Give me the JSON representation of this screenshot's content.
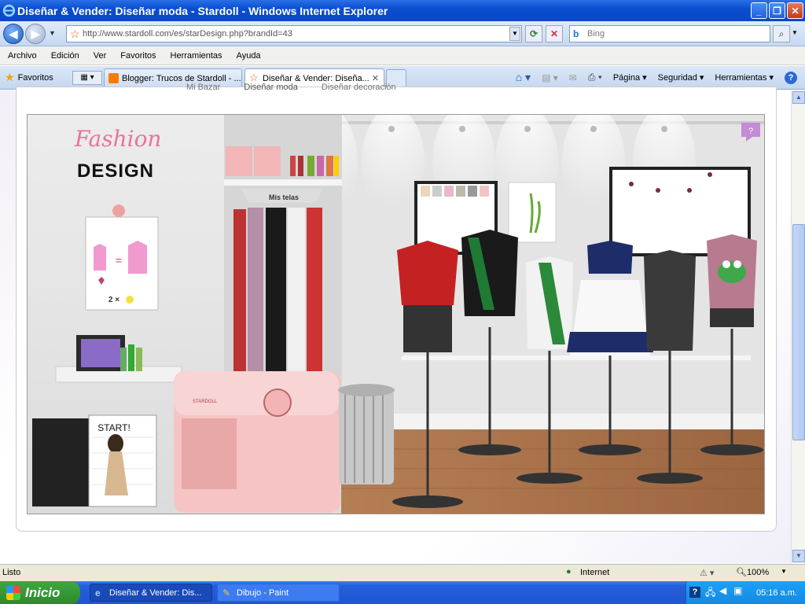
{
  "window": {
    "title": "Diseñar & Vender: Diseñar moda - Stardoll - Windows Internet Explorer"
  },
  "address": {
    "url": "http://www.stardoll.com/es/starDesign.php?brandId=43",
    "search_placeholder": "Bing"
  },
  "menu": [
    "Archivo",
    "Edición",
    "Ver",
    "Favoritos",
    "Herramientas",
    "Ayuda"
  ],
  "favorites": {
    "label": "Favoritos"
  },
  "tabs": [
    {
      "label": "Blogger: Trucos de Stardoll - ..."
    },
    {
      "label": "Diseñar & Vender: Diseña..."
    }
  ],
  "commands": [
    "Página",
    "Seguridad",
    "Herramientas"
  ],
  "page": {
    "subtabs": [
      "Mi Bazar",
      "Diseñar moda",
      "Diseñar decoración"
    ],
    "logo_top": "Fashion",
    "logo_bottom": "DESIGN",
    "shelf_label": "Mis telas",
    "equation_cost": "2 ×",
    "start_label": "START!",
    "brand": "STARDOLL",
    "help": "?"
  },
  "status": {
    "text": "Listo",
    "zone": "Internet",
    "zoom": "100%"
  },
  "taskbar": {
    "start": "Inicio",
    "items": [
      "Diseñar & Vender: Dis...",
      "Dibujo - Paint"
    ],
    "time": "05:16 a.m."
  },
  "colors": {
    "titlebar": "#0b47c4",
    "accent_pink": "#e8739f",
    "wood": "#b07a52"
  }
}
